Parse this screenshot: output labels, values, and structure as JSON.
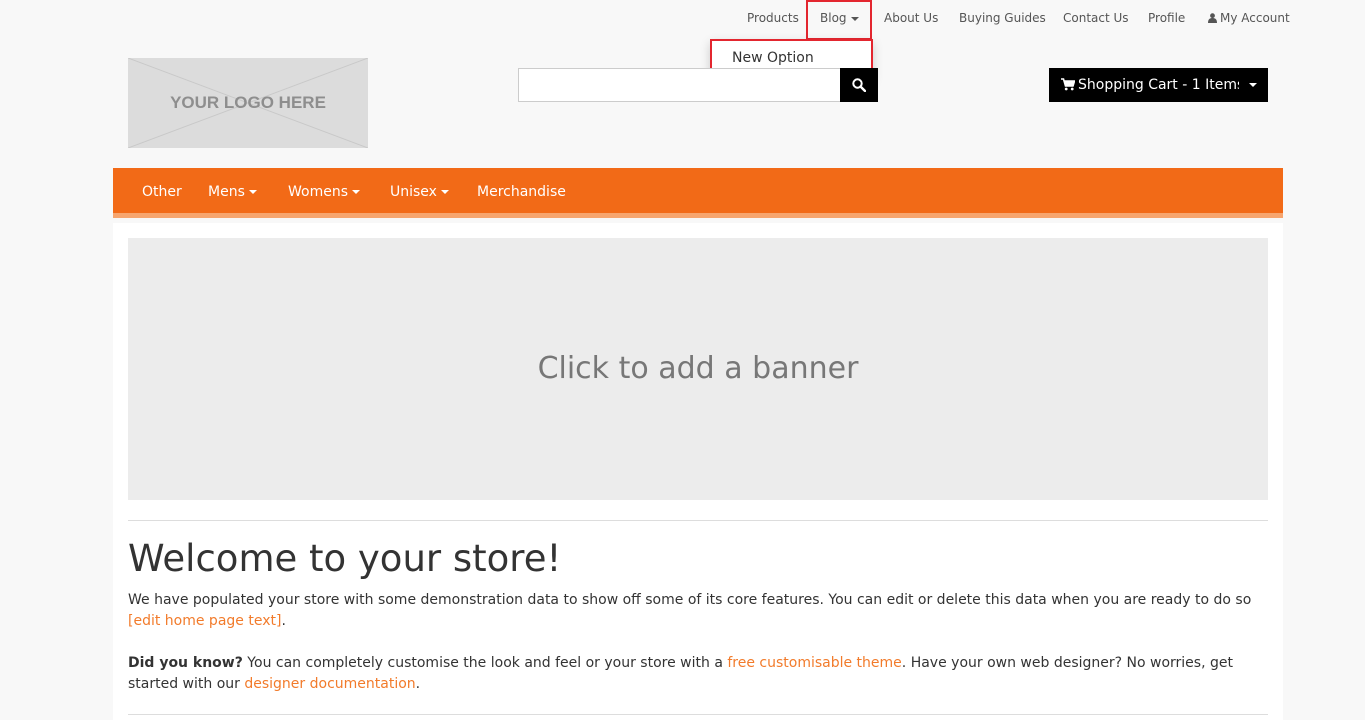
{
  "top_nav": {
    "products": "Products",
    "blog": "Blog",
    "about_us": "About Us",
    "buying_guides": "Buying Guides",
    "contact_us": "Contact Us",
    "profile": "Profile",
    "my_account": "My Account"
  },
  "blog_dropdown": {
    "items": [
      "New Option"
    ]
  },
  "logo": {
    "text": "YOUR LOGO HERE"
  },
  "search": {
    "value": "",
    "icon": "search-icon"
  },
  "cart": {
    "label": "Shopping Cart - 1 Items",
    "icon": "shopping-cart-icon"
  },
  "main_nav": {
    "items": [
      "Other",
      "Mens",
      "Womens",
      "Unisex",
      "Merchandise"
    ]
  },
  "banner": {
    "text": "Click to add a banner"
  },
  "welcome": {
    "title": "Welcome to your store!",
    "intro": "We have populated your store with some demonstration data to show off some of its core features. You can edit or delete this data when you are ready to do so ",
    "edit_link": "[edit home page text]",
    "intro_end": ".",
    "did_you_know": "Did you know?",
    "dyk_text1": " You can completely customise the look and feel or your store with a ",
    "theme_link": "free customisable theme",
    "dyk_text2": ". Have your own web designer? No worries, get started with our ",
    "designer_link": "designer documentation",
    "dyk_end": "."
  },
  "colors": {
    "accent": "#f26a17",
    "accent_light": "#f7a56e",
    "link": "#f27b2b",
    "highlight": "#e3262f"
  }
}
